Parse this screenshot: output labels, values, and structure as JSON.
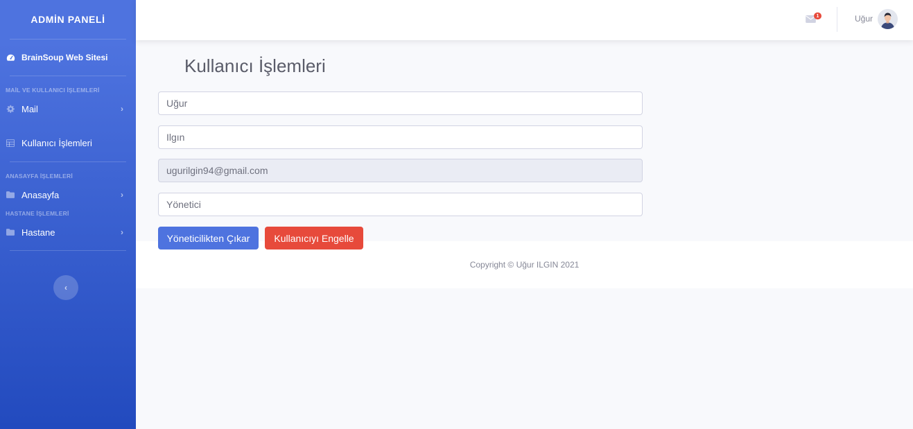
{
  "sidebar": {
    "brand": "ADMİN PANELİ",
    "dashboard_label": "BrainSoup Web Sitesi",
    "sections": [
      {
        "heading": "MAİL VE KULLANICI İŞLEMLERİ"
      },
      {
        "heading": "ANASAYFA İŞLEMLERİ"
      },
      {
        "heading": "HASTANE İŞLEMLERİ"
      }
    ],
    "items": [
      {
        "label": "Mail",
        "icon": "gear-icon"
      },
      {
        "label": "Kullanıcı İşlemleri",
        "icon": "table-icon"
      },
      {
        "label": "Anasayfa",
        "icon": "folder-icon"
      },
      {
        "label": "Hastane",
        "icon": "folder-icon"
      }
    ],
    "toggle_glyph": "‹"
  },
  "topbar": {
    "mail_badge": "1",
    "user_name": "Uğur"
  },
  "main": {
    "title": "Kullanıcı İşlemleri",
    "fields": {
      "first_name": "Uğur",
      "last_name": "Ilgın",
      "email": "ugurilgin94@gmail.com",
      "role": "Yönetici"
    },
    "buttons": {
      "remove_admin": "Yöneticilikten Çıkar",
      "block_user": "Kullanıcıyı Engelle"
    }
  },
  "footer": {
    "copyright": "Copyright © Uğur ILGIN 2021"
  },
  "colors": {
    "primary": "#4e73df",
    "danger": "#e74a3b",
    "sidebar_dark": "#224abe"
  }
}
